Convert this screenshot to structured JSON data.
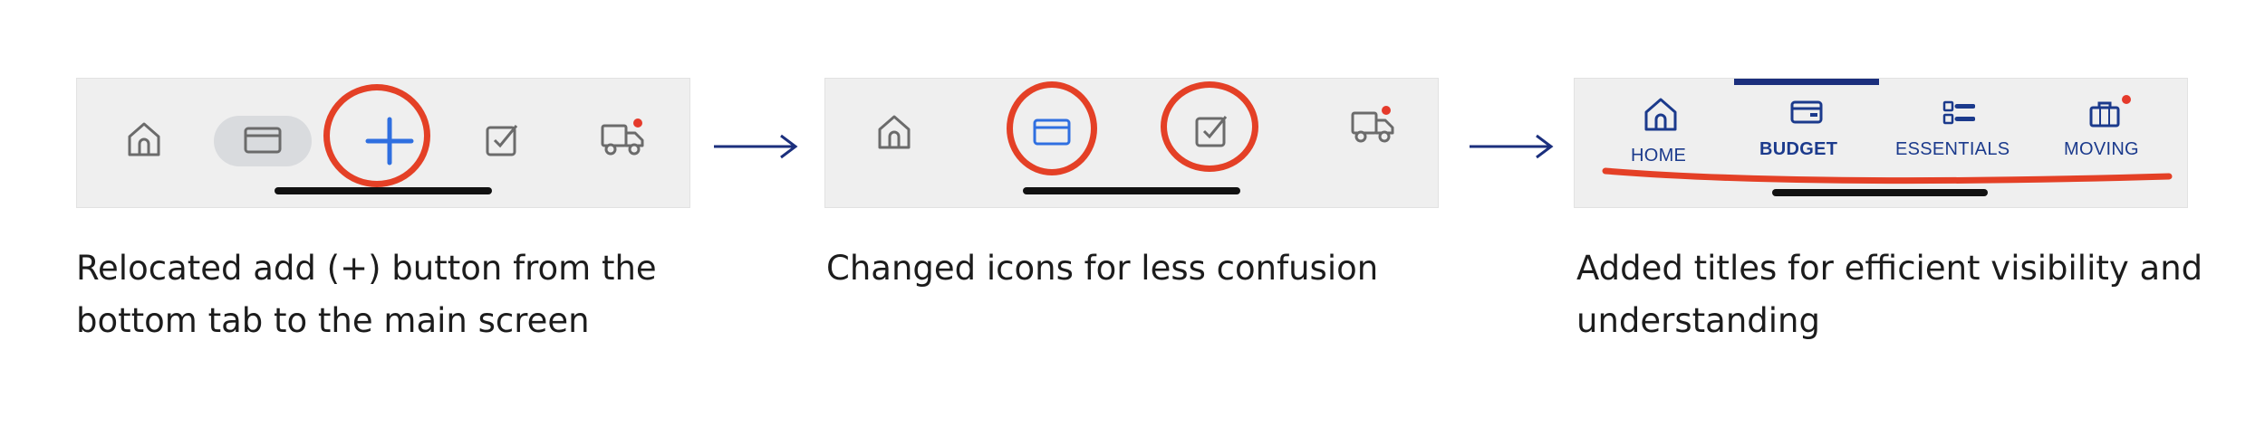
{
  "steps": [
    {
      "caption": "Relocated add (+) button from the bottom tab to the main screen",
      "tabs": [
        {
          "icon": "home-icon"
        },
        {
          "icon": "card-icon",
          "selected": true
        },
        {
          "icon": "plus-icon",
          "highlighted": true
        },
        {
          "icon": "checkbox-icon"
        },
        {
          "icon": "truck-icon",
          "notification_dot": true
        }
      ]
    },
    {
      "caption": "Changed icons for less confusion",
      "tabs": [
        {
          "icon": "home-icon"
        },
        {
          "icon": "card-icon",
          "highlighted": true
        },
        {
          "icon": "checkbox-icon",
          "highlighted": true
        },
        {
          "icon": "truck-icon",
          "notification_dot": true
        }
      ]
    },
    {
      "caption": "Added titles for efficient visibility and understanding",
      "tabs": [
        {
          "icon": "home-icon",
          "label": "HOME"
        },
        {
          "icon": "wallet-icon",
          "label": "BUDGET",
          "active": true
        },
        {
          "icon": "list-icon",
          "label": "ESSENTIALS"
        },
        {
          "icon": "briefcase-icon",
          "label": "MOVING",
          "notification_dot": true
        }
      ]
    }
  ],
  "colors": {
    "annotation": "#e44026",
    "arrow": "#1b2f7d",
    "icon_gray": "#6b6b6b",
    "accent_blue": "#2f6fe0",
    "label_navy": "#1b3a8c"
  }
}
